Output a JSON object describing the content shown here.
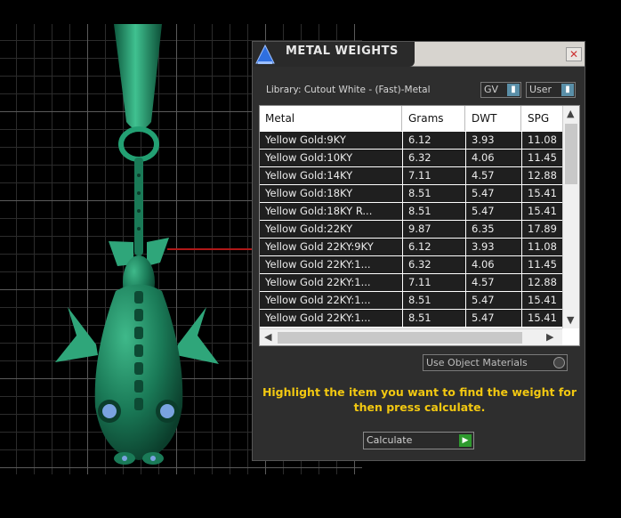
{
  "window": {
    "title": "METAL WEIGHTS",
    "close_glyph": "✕",
    "library_label": "Library: Cutout White - (Fast)-Metal",
    "unit_select": "GV",
    "user_select": "User"
  },
  "table": {
    "columns": [
      "Metal",
      "Grams",
      "DWT",
      "SPG"
    ],
    "rows": [
      [
        "Yellow Gold:9KY",
        "6.12",
        "3.93",
        "11.08"
      ],
      [
        "Yellow Gold:10KY",
        "6.32",
        "4.06",
        "11.45"
      ],
      [
        "Yellow Gold:14KY",
        "7.11",
        "4.57",
        "12.88"
      ],
      [
        "Yellow Gold:18KY",
        "8.51",
        "5.47",
        "15.41"
      ],
      [
        "Yellow Gold:18KY R...",
        "8.51",
        "5.47",
        "15.41"
      ],
      [
        "Yellow Gold:22KY",
        "9.87",
        "6.35",
        "17.89"
      ],
      [
        "Yellow Gold 22KY:9KY",
        "6.12",
        "3.93",
        "11.08"
      ],
      [
        "Yellow Gold 22KY:1...",
        "6.32",
        "4.06",
        "11.45"
      ],
      [
        "Yellow Gold 22KY:1...",
        "7.11",
        "4.57",
        "12.88"
      ],
      [
        "Yellow Gold 22KY:1...",
        "8.51",
        "5.47",
        "15.41"
      ],
      [
        "Yellow Gold 22KY:1...",
        "8.51",
        "5.47",
        "15.41"
      ]
    ]
  },
  "options": {
    "use_object_materials": "Use Object Materials"
  },
  "instruction": "Highlight the item you want to find the weight for then press calculate.",
  "actions": {
    "calculate": "Calculate"
  },
  "icons": {
    "app": "metal-weights-app-icon",
    "close": "close-icon",
    "dropdown": "dropdown-arrow-icon",
    "go": "play-arrow-icon"
  },
  "colors": {
    "instruction": "#f2c811",
    "model": "#1f8a62",
    "accent_green": "#2e9a2e",
    "select_arrow": "#5a8fa8"
  }
}
